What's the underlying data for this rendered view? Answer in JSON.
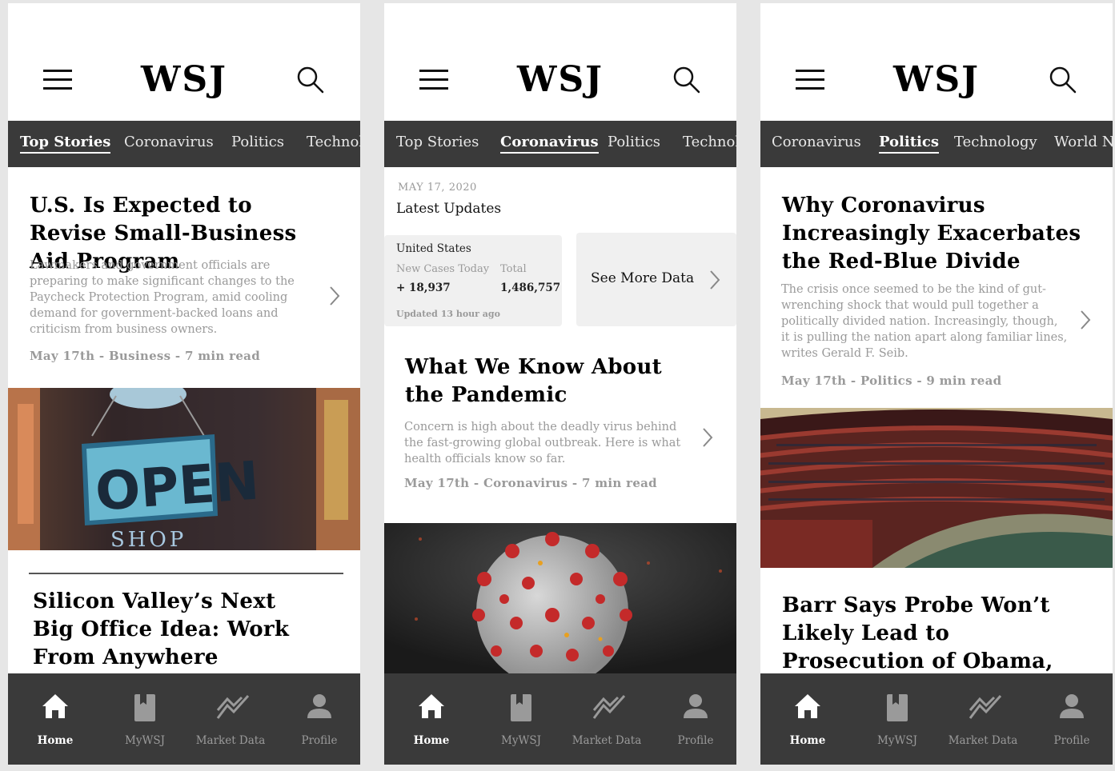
{
  "colors": {
    "dark_bar": "#3a3a3a",
    "muted_text": "#9a9a9a",
    "background": "#e6e6e6"
  },
  "logo": "WSJ",
  "icons": [
    "menu-icon",
    "search-icon",
    "chevron-right-icon",
    "home-icon",
    "book-icon",
    "chart-line-icon",
    "person-icon"
  ],
  "bottom_nav": {
    "home": "Home",
    "mywsj": "MyWSJ",
    "market": "Market Data",
    "profile": "Profile"
  },
  "screen1": {
    "tabs": [
      "Top Stories",
      "Coronavirus",
      "Politics",
      "Technology"
    ],
    "active_tab": "Top Stories",
    "article1": {
      "headline": "U.S. Is Expected to Revise Small-Business Aid Program",
      "summary": "Lawmakers and government officials are preparing to make significant changes to the Paycheck Protection Program, amid cooling demand for government-backed loans and criticism from business owners.",
      "meta": "May 17th - Business - 7 min read"
    },
    "image_text": {
      "sign": "OPEN",
      "shop": "SHOP"
    },
    "article2": {
      "headline": "Silicon Valley’s Next Big Office Idea: Work From Anywhere"
    }
  },
  "screen2": {
    "tabs": [
      "Top Stories",
      "Coronavirus",
      "Politics",
      "Technology"
    ],
    "active_tab": "Coronavirus",
    "date": "MAY 17, 2020",
    "section_title": "Latest Updates",
    "stats": {
      "region": "United States",
      "new_cases_label": "New Cases Today",
      "new_cases_value": "+ 18,937",
      "total_label": "Total",
      "total_value": "1,486,757",
      "updated": "Updated 13 hour ago"
    },
    "see_more": "See More Data",
    "article1": {
      "headline": "What We Know About the Pandemic",
      "summary": "Concern is high about the deadly virus behind the fast-growing global outbreak. Here is what health officials know so far.",
      "meta": "May 17th - Coronavirus - 7 min read"
    }
  },
  "screen3": {
    "tabs": [
      "Coronavirus",
      "Politics",
      "Technology",
      "World News"
    ],
    "active_tab": "Politics",
    "article1": {
      "headline": "Why Coronavirus Increasingly Exacerbates the Red-Blue Divide",
      "summary": "The crisis once seemed to be the kind of gut-wrenching shock that would pull together a politically divided nation. Increasingly, though, it is pulling the nation apart along familiar lines, writes Gerald F. Seib.",
      "meta": "May 17th - Politics - 9 min read"
    },
    "article2": {
      "headline": "Barr Says Probe Won’t Likely Lead to Prosecution of Obama, Biden"
    }
  }
}
